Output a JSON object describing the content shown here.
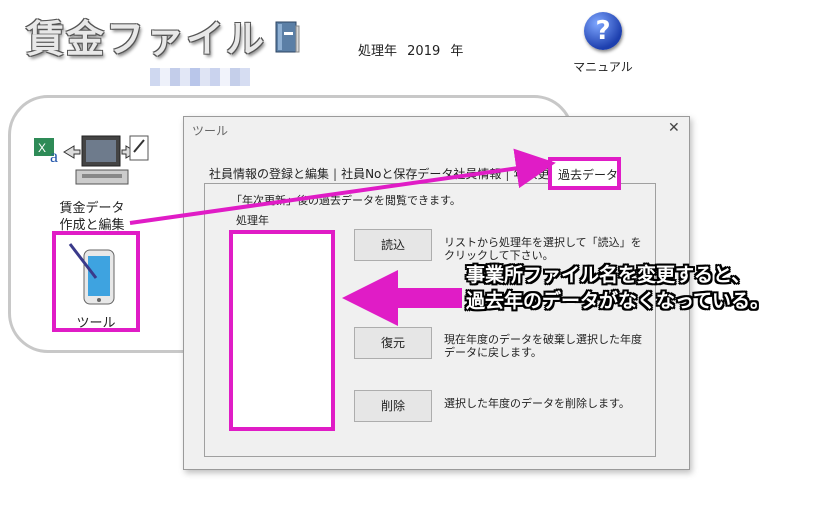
{
  "app": {
    "title": "賃金ファイル",
    "year_prefix": "処理年",
    "year_value": "2019",
    "year_suffix": "年",
    "manual_label": "マニュアル"
  },
  "panel": {
    "wage_data_label_line1": "賃金データ",
    "wage_data_label_line2": "作成と編集",
    "tool_label": "ツール"
  },
  "dialog": {
    "title": "ツール",
    "close_glyph": "✕",
    "tabs": [
      {
        "label": "社員情報の登録と編集"
      },
      {
        "label": "社員Noと保存データ社員情報"
      },
      {
        "label": "年次更新"
      }
    ],
    "active_tab": "過去データ",
    "instruction": "「年次更新」後の過去データを閲覧できます。",
    "list_label": "処理年",
    "buttons": {
      "load": {
        "label": "読込",
        "desc": "リストから処理年を選択して「読込」をクリックして下さい。"
      },
      "restore": {
        "label": "復元",
        "desc": "現在年度のデータを破棄し選択した年度データに戻します。"
      },
      "delete": {
        "label": "削除",
        "desc": "選択した年度のデータを削除します。"
      }
    }
  },
  "callout": {
    "line1": "事業所ファイル名を変更すると、",
    "line2": "過去年のデータがなくなっている。"
  },
  "colors": {
    "highlight": "#e01cc6",
    "dialog_bg": "#f0f0f0",
    "panel_border": "#c8c8c8"
  }
}
